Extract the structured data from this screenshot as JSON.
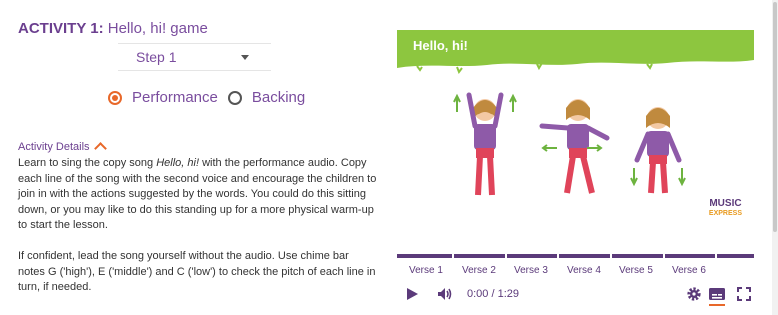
{
  "activity": {
    "label": "ACTIVITY 1:",
    "name": " Hello, hi! game"
  },
  "step_select": {
    "selected": "Step 1"
  },
  "audio_mode": {
    "options": [
      "Performance",
      "Backing"
    ],
    "selected": "Performance"
  },
  "details": {
    "heading": "Activity Details",
    "para1_a": "Learn to sing the copy song ",
    "para1_song": "Hello, hi!",
    "para1_b": " with the performance audio. Copy each line of the song with the second voice and encourage the children to join in with the actions suggested by the words. You could do this sitting down, or you may like to do this standing up for a more physical warm-up to start the lesson.",
    "para2": "If confident, lead the song yourself without the audio. Use chime bar notes G ('high'), E ('middle') and C ('low') to check the pitch of each line in turn, if needed."
  },
  "video": {
    "title": "Hello, hi!",
    "brand_line1": "MUSIC",
    "brand_line2": "EXPRESS",
    "verses": [
      "Verse 1",
      "Verse 2",
      "Verse 3",
      "Verse 4",
      "Verse 5",
      "Verse 6"
    ],
    "time": "0:00 / 1:29"
  },
  "colors": {
    "accent": "#e8682a",
    "purple": "#6b3f8f",
    "green": "#8dc63f"
  },
  "icons": [
    "play-icon",
    "volume-icon",
    "settings-icon",
    "subtitles-icon",
    "fullscreen-icon",
    "chevron-up-icon"
  ]
}
